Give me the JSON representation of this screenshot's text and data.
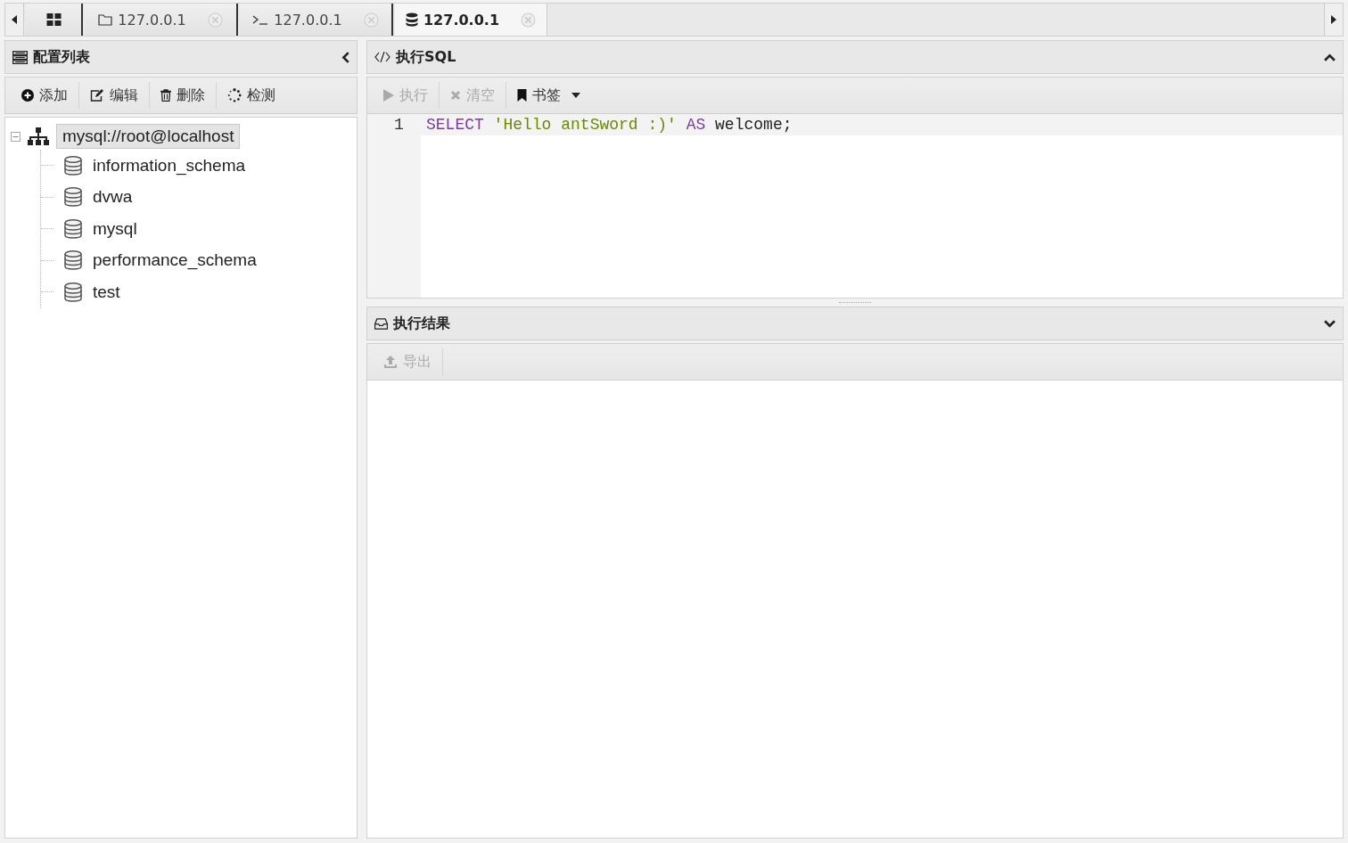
{
  "tabs": [
    {
      "kind": "home",
      "selected": false
    },
    {
      "kind": "folder",
      "label": "127.0.0.1",
      "selected": false
    },
    {
      "kind": "terminal",
      "label": "127.0.0.1",
      "selected": false
    },
    {
      "kind": "database",
      "label": "127.0.0.1",
      "selected": true
    }
  ],
  "config_panel": {
    "title": "配置列表",
    "toolbar": [
      {
        "kind": "add",
        "label": "添加",
        "disabled": false
      },
      {
        "kind": "edit",
        "label": "编辑",
        "disabled": false
      },
      {
        "kind": "delete",
        "label": "删除",
        "disabled": false
      },
      {
        "kind": "check",
        "label": "检测",
        "disabled": false
      }
    ],
    "tree": [
      {
        "label": "mysql://root@localhost",
        "expanded": true,
        "selected": true,
        "children": [
          {
            "label": "information_schema"
          },
          {
            "label": "dvwa"
          },
          {
            "label": "mysql"
          },
          {
            "label": "performance_schema"
          },
          {
            "label": "test"
          }
        ]
      }
    ]
  },
  "sql_panel": {
    "title": "执行SQL",
    "toolbar": [
      {
        "kind": "run",
        "label": "执行",
        "disabled": true
      },
      {
        "kind": "clear",
        "label": "清空",
        "disabled": true
      },
      {
        "kind": "bookmark",
        "label": "书签",
        "disabled": false
      }
    ],
    "editor": {
      "lines": [
        {
          "number": "1",
          "tokens": [
            {
              "kind": "keyword",
              "text": "SELECT"
            },
            {
              "kind": "string",
              "text": " 'Hello antSword :)'"
            },
            {
              "kind": "keyword",
              "text": " AS"
            },
            {
              "kind": "plain",
              "text": " welcome;"
            }
          ]
        }
      ]
    }
  },
  "result_panel": {
    "title": "执行结果",
    "toolbar": [
      {
        "kind": "export",
        "label": "导出",
        "disabled": true
      }
    ]
  }
}
